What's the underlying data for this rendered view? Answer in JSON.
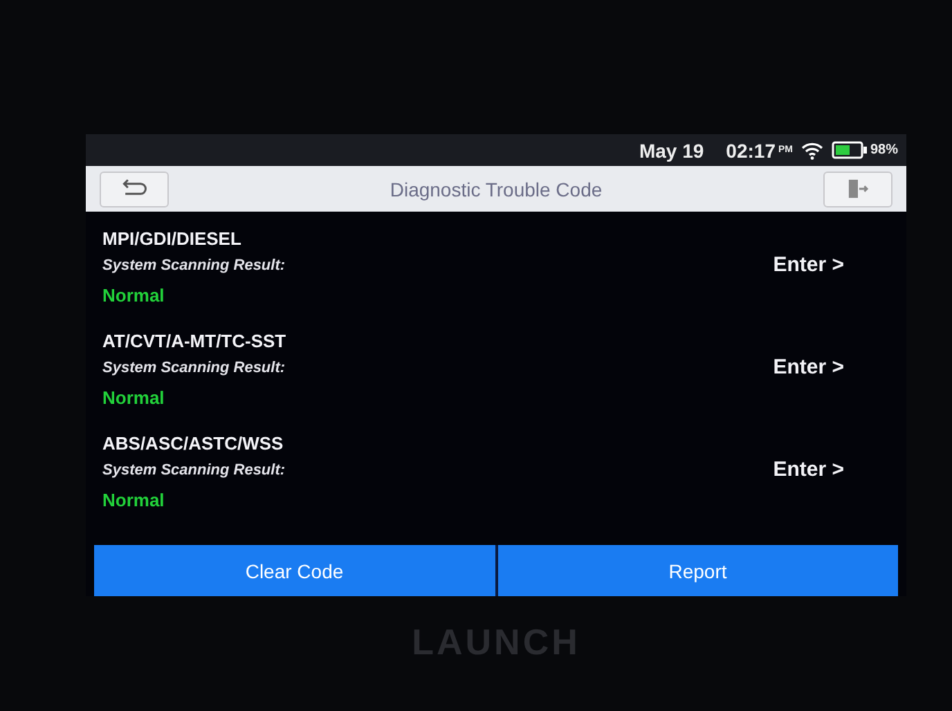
{
  "status_bar": {
    "date": "May 19",
    "time": "02:17",
    "meridiem": "PM",
    "battery": "98%"
  },
  "header": {
    "title": "Diagnostic Trouble Code"
  },
  "systems": [
    {
      "name": "MPI/GDI/DIESEL",
      "result_label": "System Scanning Result:",
      "status": "Normal",
      "color": "#22d13a",
      "action": "Enter >"
    },
    {
      "name": "AT/CVT/A-MT/TC-SST",
      "result_label": "System Scanning Result:",
      "status": "Normal",
      "color": "#22d13a",
      "action": "Enter >"
    },
    {
      "name": "ABS/ASC/ASTC/WSS",
      "result_label": "System Scanning Result:",
      "status": "Normal",
      "color": "#22d13a",
      "action": "Enter >"
    }
  ],
  "buttons": [
    "Clear Code",
    "Report"
  ],
  "device_brand": "LAUNCH"
}
